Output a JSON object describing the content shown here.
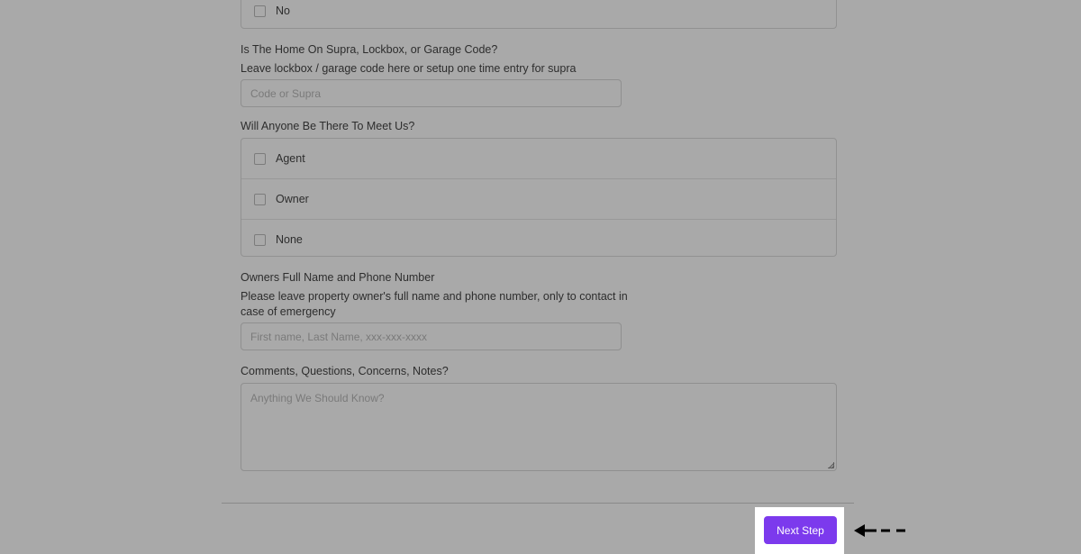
{
  "prev_question": {
    "option_no": "No"
  },
  "access": {
    "question": "Is The Home On Supra, Lockbox, or Garage Code?",
    "help": "Leave lockbox / garage code here or setup one time entry for supra",
    "placeholder": "Code or Supra",
    "value": ""
  },
  "meet": {
    "question": "Will Anyone Be There To Meet Us?",
    "options": [
      "Agent",
      "Owner",
      "None"
    ]
  },
  "owner": {
    "question": "Owners Full Name and Phone Number",
    "help": "Please leave property owner's full name and phone number, only to contact in case of emergency",
    "placeholder": "First name, Last Name, xxx-xxx-xxxx",
    "value": ""
  },
  "comments": {
    "question": "Comments, Questions, Concerns, Notes?",
    "placeholder": "Anything We Should Know?",
    "value": ""
  },
  "footer": {
    "next_label": "Next Step"
  },
  "colors": {
    "accent": "#7c3aed",
    "overlay": "#a9a9a9",
    "highlight": "#ffffff"
  },
  "icons": {
    "pointer": "left-arrow-icon"
  }
}
